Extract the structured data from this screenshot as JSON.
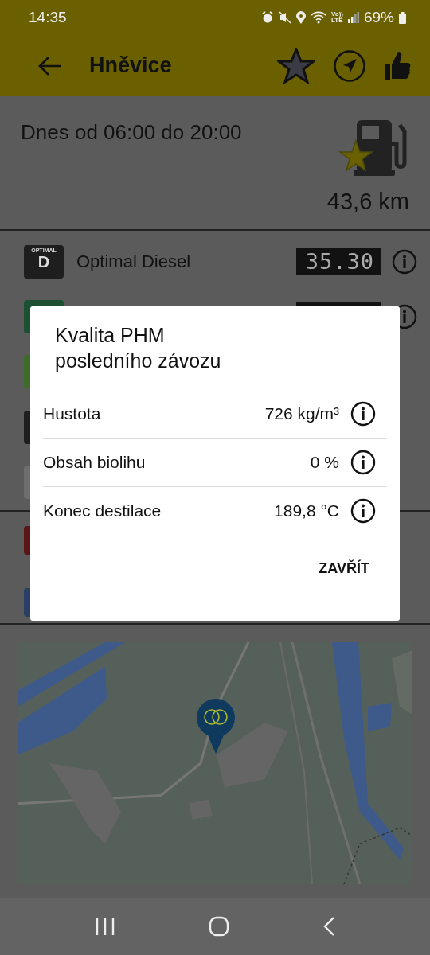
{
  "status_bar": {
    "time": "14:35",
    "network": [
      "Vo))",
      "LTE"
    ],
    "battery": "69%"
  },
  "app_bar": {
    "title": "Hněvice",
    "favorite": true
  },
  "station": {
    "hours": "Dnes od 06:00 do 20:00",
    "distance": "43,6 km"
  },
  "fuels": [
    {
      "kind": "full",
      "badge_top": "OPTIMAL",
      "badge_letter": "D",
      "name": "Optimal Diesel",
      "price": "35.30",
      "color": "#1e1e1e"
    },
    {
      "kind": "partial",
      "color": "#1d4f33"
    },
    {
      "kind": "sliver",
      "color": "#3f6b2a"
    },
    {
      "kind": "sliver",
      "color": "#1e1e1e"
    },
    {
      "kind": "sliver",
      "color": "#6e6e6e"
    }
  ],
  "services": [
    {
      "color": "#5a1616"
    },
    {
      "color": "#2a3e66"
    }
  ],
  "dialog": {
    "title": "Kvalita PHM\nposledního závozu",
    "rows": [
      {
        "label": "Hustota",
        "value": "726 kg/m³"
      },
      {
        "label": "Obsah biolihu",
        "value": "0 %"
      },
      {
        "label": "Konec destilace",
        "value": "189,8 °C"
      }
    ],
    "close": "ZAVŘÍT"
  }
}
